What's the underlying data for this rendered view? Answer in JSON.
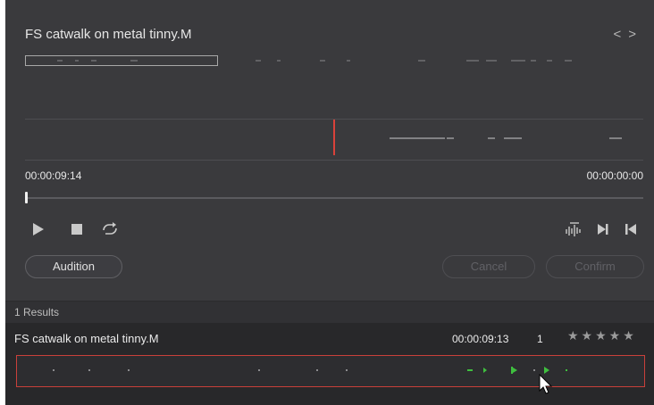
{
  "player": {
    "title": "FS catwalk on metal tinny.M",
    "nav_prev": "<",
    "nav_next": ">",
    "time_current": "00:00:09:14",
    "time_end": "00:00:00:00"
  },
  "buttons": {
    "audition": "Audition",
    "cancel": "Cancel",
    "confirm": "Confirm"
  },
  "results": {
    "header": "1 Results",
    "items": [
      {
        "name": "FS catwalk on metal tinny.M",
        "duration": "00:00:09:13",
        "count": "1",
        "stars": "★★★★★"
      }
    ]
  },
  "colors": {
    "playhead": "#d9423a",
    "selection_border": "#c9403a",
    "marker_green": "#3fbf3f",
    "panel_bg": "#3a3a3d"
  },
  "icons": [
    "play-icon",
    "stop-icon",
    "loop-icon",
    "waveform-mix-icon",
    "next-frame-icon",
    "previous-frame-icon",
    "pointer-cursor-icon"
  ]
}
